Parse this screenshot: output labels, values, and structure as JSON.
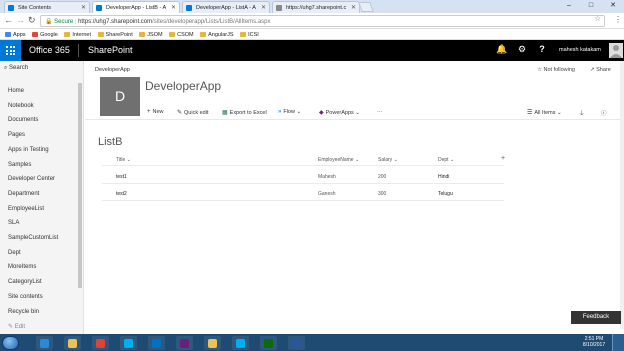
{
  "browser": {
    "tabs": [
      {
        "label": "Site Contents",
        "favicon_color": "#0078d7"
      },
      {
        "label": "DeveloperApp - ListB - A",
        "favicon_color": "#0078d7"
      },
      {
        "label": "DeveloperApp - ListA - A",
        "favicon_color": "#0078d7"
      },
      {
        "label": "https://uhg7.sharepoint.c",
        "favicon_color": "#888888"
      }
    ],
    "window_controls": [
      "‒",
      "□",
      "✕"
    ],
    "address": {
      "secure_label": "Secure",
      "url_host": "https://uhg7.sharepoint.com",
      "url_path": "/sites/developerapp/Lists/ListB/AllItems.aspx"
    },
    "bookmarks": [
      {
        "label": "Apps",
        "color": "#4285f4"
      },
      {
        "label": "Google",
        "color": "#ea4335"
      },
      {
        "label": "Internet",
        "color": "#e8b43a"
      },
      {
        "label": "SharePoint",
        "color": "#e8b43a"
      },
      {
        "label": "JSOM",
        "color": "#e8b43a"
      },
      {
        "label": "CSOM",
        "color": "#e8b43a"
      },
      {
        "label": "AngularJS",
        "color": "#e8b43a"
      },
      {
        "label": "ICSI",
        "color": "#e8b43a"
      }
    ]
  },
  "suitebar": {
    "app_name": "Office 365",
    "product": "SharePoint",
    "user": "mahesh katakam"
  },
  "leftnav": {
    "search_label": "Search",
    "items": [
      "Home",
      "Notebook",
      "Documents",
      "Pages",
      "Apps in Testing",
      "Samples",
      "Developer Center",
      "Department",
      "EmployeeList",
      "SLA",
      "SampleCustomList",
      "Dept",
      "MoreItems",
      "CategoryList",
      "Site contents",
      "Recycle bin"
    ],
    "edit_label": "Edit"
  },
  "site": {
    "breadcrumb": "DeveloperApp",
    "logo_letter": "D",
    "title": "DeveloperApp",
    "not_following": "Not following",
    "share": "Share"
  },
  "commandbar": {
    "new": "New",
    "quick_edit": "Quick edit",
    "export": "Export to Excel",
    "flow": "Flow",
    "powerapps": "PowerApps",
    "more": "···",
    "view": "All Items"
  },
  "list": {
    "title": "ListB",
    "columns": [
      "Title",
      "EmployeeName",
      "Salary",
      "Dept"
    ],
    "rows": [
      [
        "test1",
        "Mahesh",
        "200",
        "Hindi"
      ],
      [
        "test2",
        "Ganesh",
        "300",
        "Telugu"
      ]
    ]
  },
  "feedback_label": "Feedback",
  "taskbar": {
    "time": "2:51 PM",
    "date": "8/10/2017",
    "apps": [
      {
        "name": "ie",
        "color": "#2a8ad8"
      },
      {
        "name": "explorer",
        "color": "#e9c356"
      },
      {
        "name": "chrome",
        "color": "#db4437"
      },
      {
        "name": "skype",
        "color": "#00aff0"
      },
      {
        "name": "outlook",
        "color": "#0072c6"
      },
      {
        "name": "visual-studio",
        "color": "#68217a"
      },
      {
        "name": "folder",
        "color": "#e9c356"
      },
      {
        "name": "skype-business",
        "color": "#00aff0"
      },
      {
        "name": "sharepoint-designer",
        "color": "#0b6a0b"
      },
      {
        "name": "word",
        "color": "#2b579a"
      }
    ]
  }
}
